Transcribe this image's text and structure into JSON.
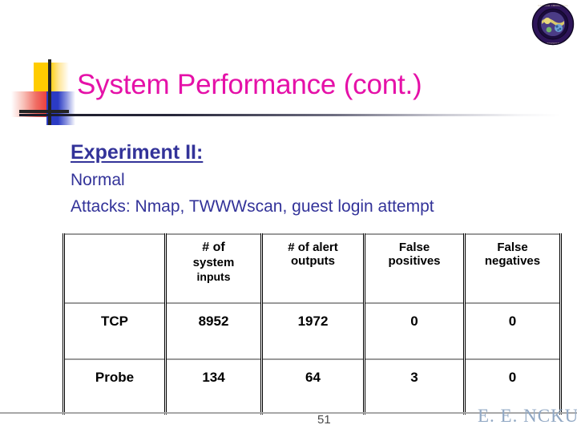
{
  "slide": {
    "title": "System Performance (cont.)",
    "title_color": "#E511A8",
    "body_color": "#333399"
  },
  "content": {
    "heading": "Experiment II:",
    "line_normal": "Normal",
    "line_attacks": "Attacks: Nmap, TWWWscan, guest login attempt"
  },
  "table": {
    "columns": [
      {
        "id": "label",
        "header_lines": []
      },
      {
        "id": "system_inputs",
        "header_lines": [
          "#  of",
          "system",
          "inputs"
        ]
      },
      {
        "id": "alert_outputs",
        "header_lines": [
          "# of alert",
          "outputs"
        ]
      },
      {
        "id": "false_positives",
        "header_lines": [
          "False",
          "positives"
        ]
      },
      {
        "id": "false_negatives",
        "header_lines": [
          "False",
          "negatives"
        ]
      }
    ],
    "rows": [
      {
        "label": "TCP",
        "system_inputs": "8952",
        "alert_outputs": "1972",
        "false_positives": "0",
        "false_negatives": "0"
      },
      {
        "label": "Probe",
        "system_inputs": "134",
        "alert_outputs": "64",
        "false_positives": "3",
        "false_negatives": "0"
      }
    ]
  },
  "footer": {
    "page_number": "51",
    "watermark": "E. E. NCKU"
  },
  "decor": {
    "seal_name": "university-seal",
    "motif_name": "square-motif"
  }
}
